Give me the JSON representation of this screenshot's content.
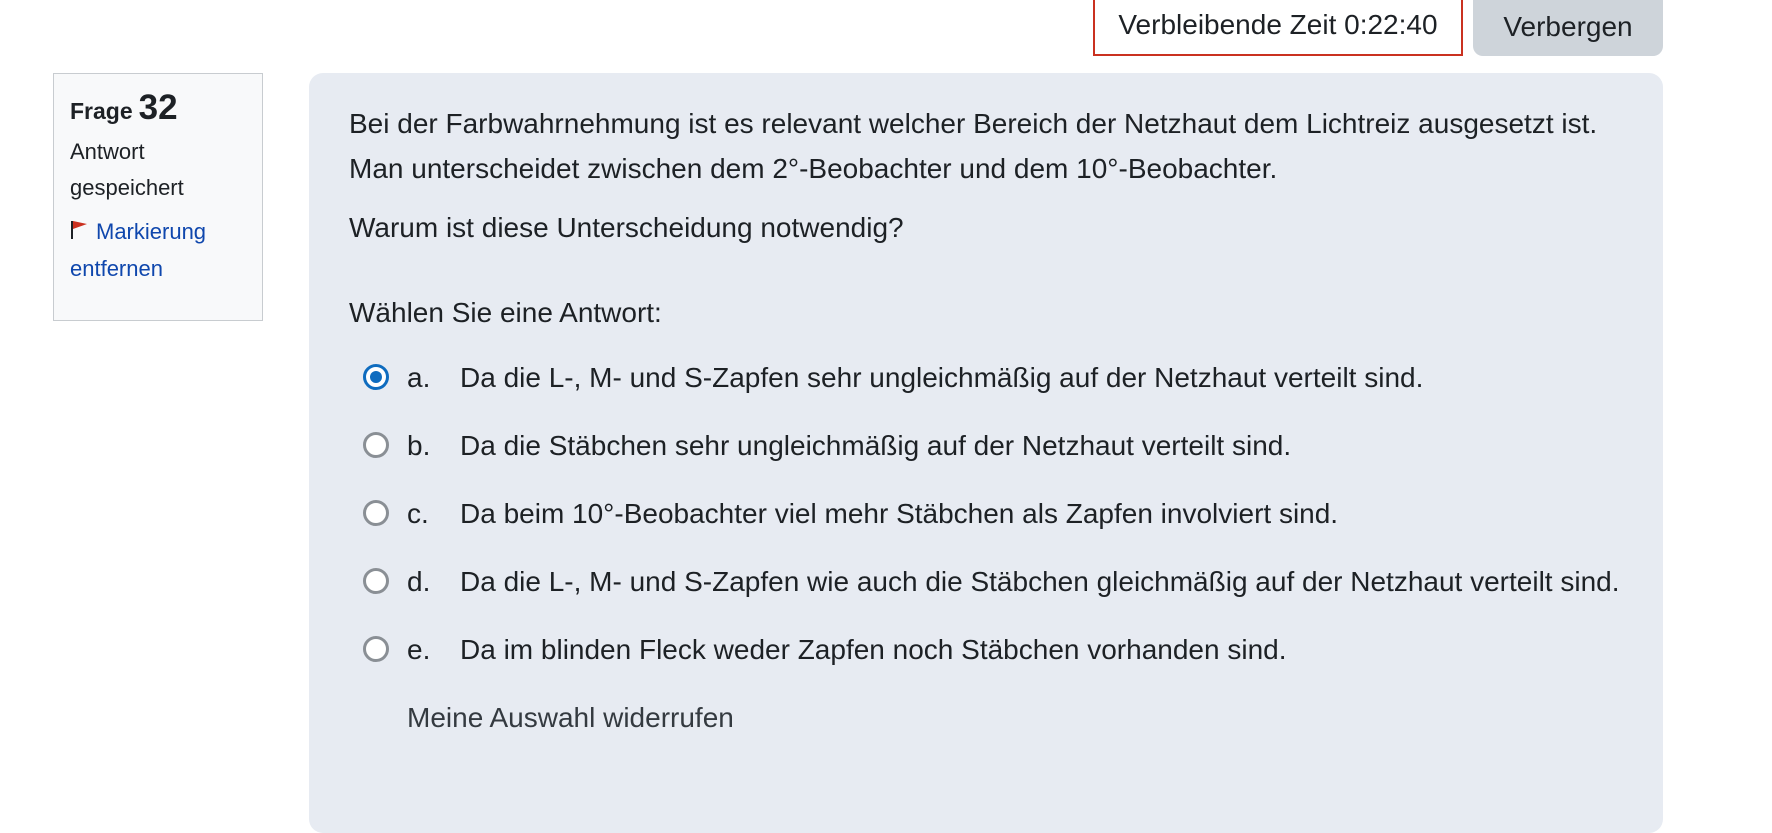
{
  "timer": {
    "text": "Verbleibende Zeit 0:22:40"
  },
  "hide_button": {
    "label": "Verbergen"
  },
  "info": {
    "label": "Frage",
    "number": "32",
    "state": "Antwort gespeichert",
    "flag_label": "Markierung entfernen",
    "flag_icon": "flag-icon",
    "flag_color": "#ca3120"
  },
  "question": {
    "text1": "Bei der Farbwahrnehmung ist es relevant welcher Bereich der Netzhaut dem Lichtreiz ausgesetzt ist. Man unterscheidet zwischen dem 2°-Beobachter und dem 10°-Beobachter.",
    "text2": "Warum ist diese Unterscheidung notwendig?",
    "prompt": "Wählen Sie eine Antwort:",
    "answers": [
      {
        "letter": "a.",
        "text": "Da die L-, M- und S-Zapfen sehr ungleichmäßig auf der Netzhaut verteilt sind.",
        "selected": true
      },
      {
        "letter": "b.",
        "text": "Da die Stäbchen sehr ungleichmäßig auf der Netzhaut verteilt sind.",
        "selected": false
      },
      {
        "letter": "c.",
        "text": "Da beim 10°-Beobachter viel mehr Stäbchen als Zapfen involviert sind.",
        "selected": false
      },
      {
        "letter": "d.",
        "text": "Da die L-, M- und S-Zapfen wie auch die Stäbchen gleichmäßig auf der Netzhaut verteilt sind.",
        "selected": false
      },
      {
        "letter": "e.",
        "text": "Da im blinden Fleck weder Zapfen noch Stäbchen vorhanden sind.",
        "selected": false
      }
    ],
    "clear_label": "Meine Auswahl widerrufen"
  },
  "colors": {
    "accent": "#0f6cbf",
    "timer_border": "#ca3120",
    "content_bg": "#e7ebf2",
    "link": "#0f47ad"
  }
}
